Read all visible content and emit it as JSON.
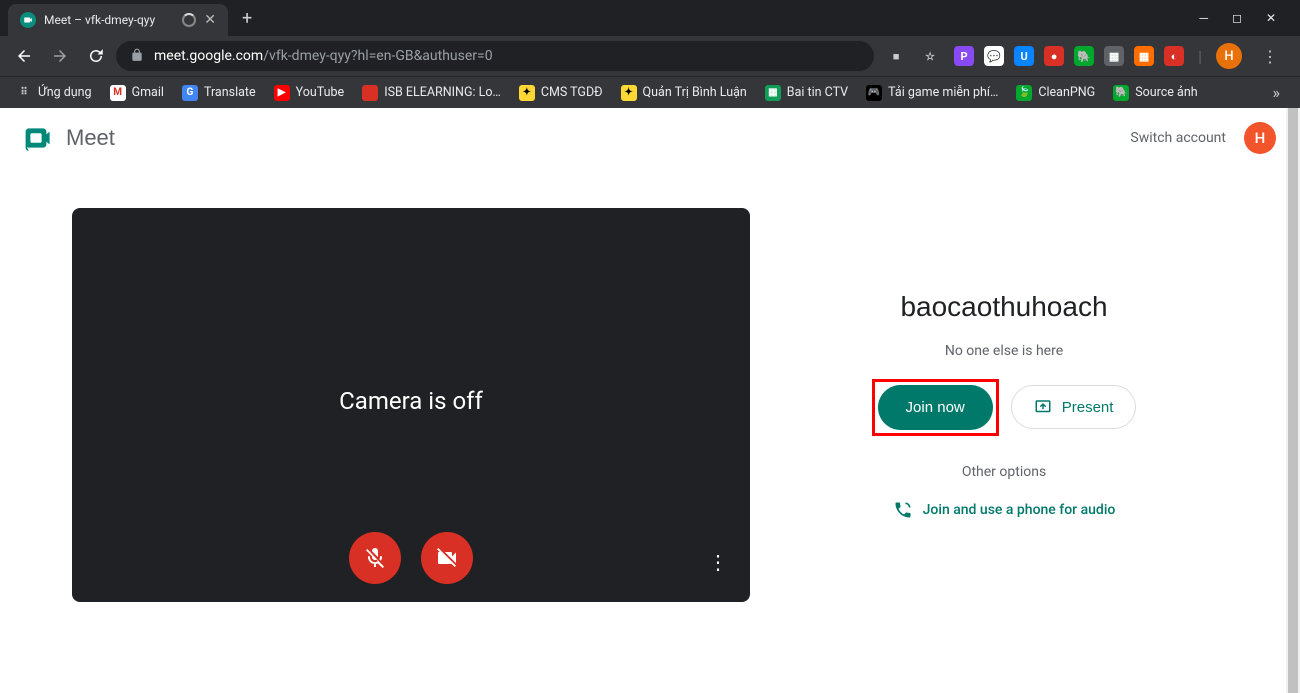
{
  "browser": {
    "tab": {
      "title": "Meet – vfk-dmey-qyy"
    },
    "url_host": "meet.google.com",
    "url_path": "/vfk-dmey-qyy?hl=en-GB&authuser=0",
    "avatar_letter": "H",
    "extensions": [
      {
        "bg": "#8a4af3",
        "txt": "P"
      },
      {
        "bg": "#fff",
        "txt": "💬"
      },
      {
        "bg": "#0a84ff",
        "txt": "U"
      },
      {
        "bg": "#d93025",
        "txt": "●"
      },
      {
        "bg": "#00a82d",
        "txt": "🐘"
      },
      {
        "bg": "#5f6368",
        "txt": "▦"
      },
      {
        "bg": "#ff6d00",
        "txt": "▦"
      },
      {
        "bg": "#d93025",
        "txt": "◐"
      }
    ]
  },
  "bookmarks": [
    {
      "label": "Ứng dụng",
      "iconBg": "transparent",
      "iconTxt": "⠿",
      "iconColor": "#ccc"
    },
    {
      "label": "Gmail",
      "iconBg": "#fff",
      "iconTxt": "M",
      "iconColor": "#d93025"
    },
    {
      "label": "Translate",
      "iconBg": "#4285f4",
      "iconTxt": "G",
      "iconColor": "#fff"
    },
    {
      "label": "YouTube",
      "iconBg": "#ff0000",
      "iconTxt": "▶",
      "iconColor": "#fff"
    },
    {
      "label": "ISB ELEARNING: Lo…",
      "iconBg": "#d93025",
      "iconTxt": " ",
      "iconColor": "#fff"
    },
    {
      "label": "CMS TGDĐ",
      "iconBg": "#fdd835",
      "iconTxt": "✦",
      "iconColor": "#000"
    },
    {
      "label": "Quản Trị Bình Luận",
      "iconBg": "#fdd835",
      "iconTxt": "✦",
      "iconColor": "#000"
    },
    {
      "label": "Bai tin CTV",
      "iconBg": "#0f9d58",
      "iconTxt": "▦",
      "iconColor": "#fff"
    },
    {
      "label": "Tải game miễn phí…",
      "iconBg": "#000",
      "iconTxt": "🎮",
      "iconColor": "#fff"
    },
    {
      "label": "CleanPNG",
      "iconBg": "#00a82d",
      "iconTxt": "🍃",
      "iconColor": "#fff"
    },
    {
      "label": "Source ảnh",
      "iconBg": "#00a82d",
      "iconTxt": "🐘",
      "iconColor": "#fff"
    }
  ],
  "meet": {
    "product_name": "Meet",
    "switch_account": "Switch account",
    "avatar_letter": "H",
    "camera_off": "Camera is off",
    "meeting_title": "baocaothuhoach",
    "presence": "No one else is here",
    "join_label": "Join now",
    "present_label": "Present",
    "other_options": "Other options",
    "phone_audio": "Join and use a phone for audio"
  }
}
